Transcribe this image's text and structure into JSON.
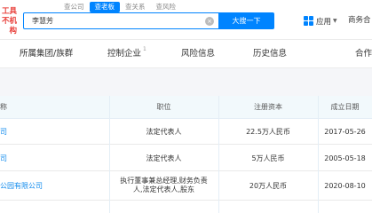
{
  "header": {
    "logo_lines": [
      "工具",
      "不机构"
    ],
    "search_tabs": [
      {
        "label": "查公司",
        "active": false
      },
      {
        "label": "查老板",
        "active": true
      },
      {
        "label": "查关系",
        "active": false
      },
      {
        "label": "查风险",
        "active": false
      }
    ],
    "search": {
      "value": "李慧芳",
      "button_label": "大搜一下"
    },
    "apps_label": "应用",
    "business_label": "商务合"
  },
  "nav": {
    "items": [
      {
        "label": "所属集团/族群",
        "sup": ""
      },
      {
        "label": "控制企业",
        "sup": "1"
      },
      {
        "label": "风险信息",
        "sup": ""
      },
      {
        "label": "历史信息",
        "sup": ""
      },
      {
        "label": "合作"
      }
    ]
  },
  "table": {
    "headers": [
      "称",
      "职位",
      "注册资本",
      "成立日期"
    ],
    "rows": [
      {
        "name": "司",
        "position": "法定代表人",
        "capital": "22.5万人民币",
        "date": "2017-05-26"
      },
      {
        "name": "司",
        "position": "法定代表人",
        "capital": "5万人民币",
        "date": "2005-05-18"
      },
      {
        "name": "公园有限公司",
        "position_lines": [
          "执行董事兼总经理,财务负责",
          "人,法定代表人,股东"
        ],
        "capital": "20万人民币",
        "date": "2020-08-10"
      },
      {
        "name": "",
        "position": "",
        "capital": "",
        "date": ""
      }
    ]
  },
  "colors": {
    "accent": "#0084ff",
    "link": "#128bed",
    "logo": "#e83f3a",
    "table_header_bg": "#f2f9fc",
    "gap_bg": "#f5f6f9"
  }
}
